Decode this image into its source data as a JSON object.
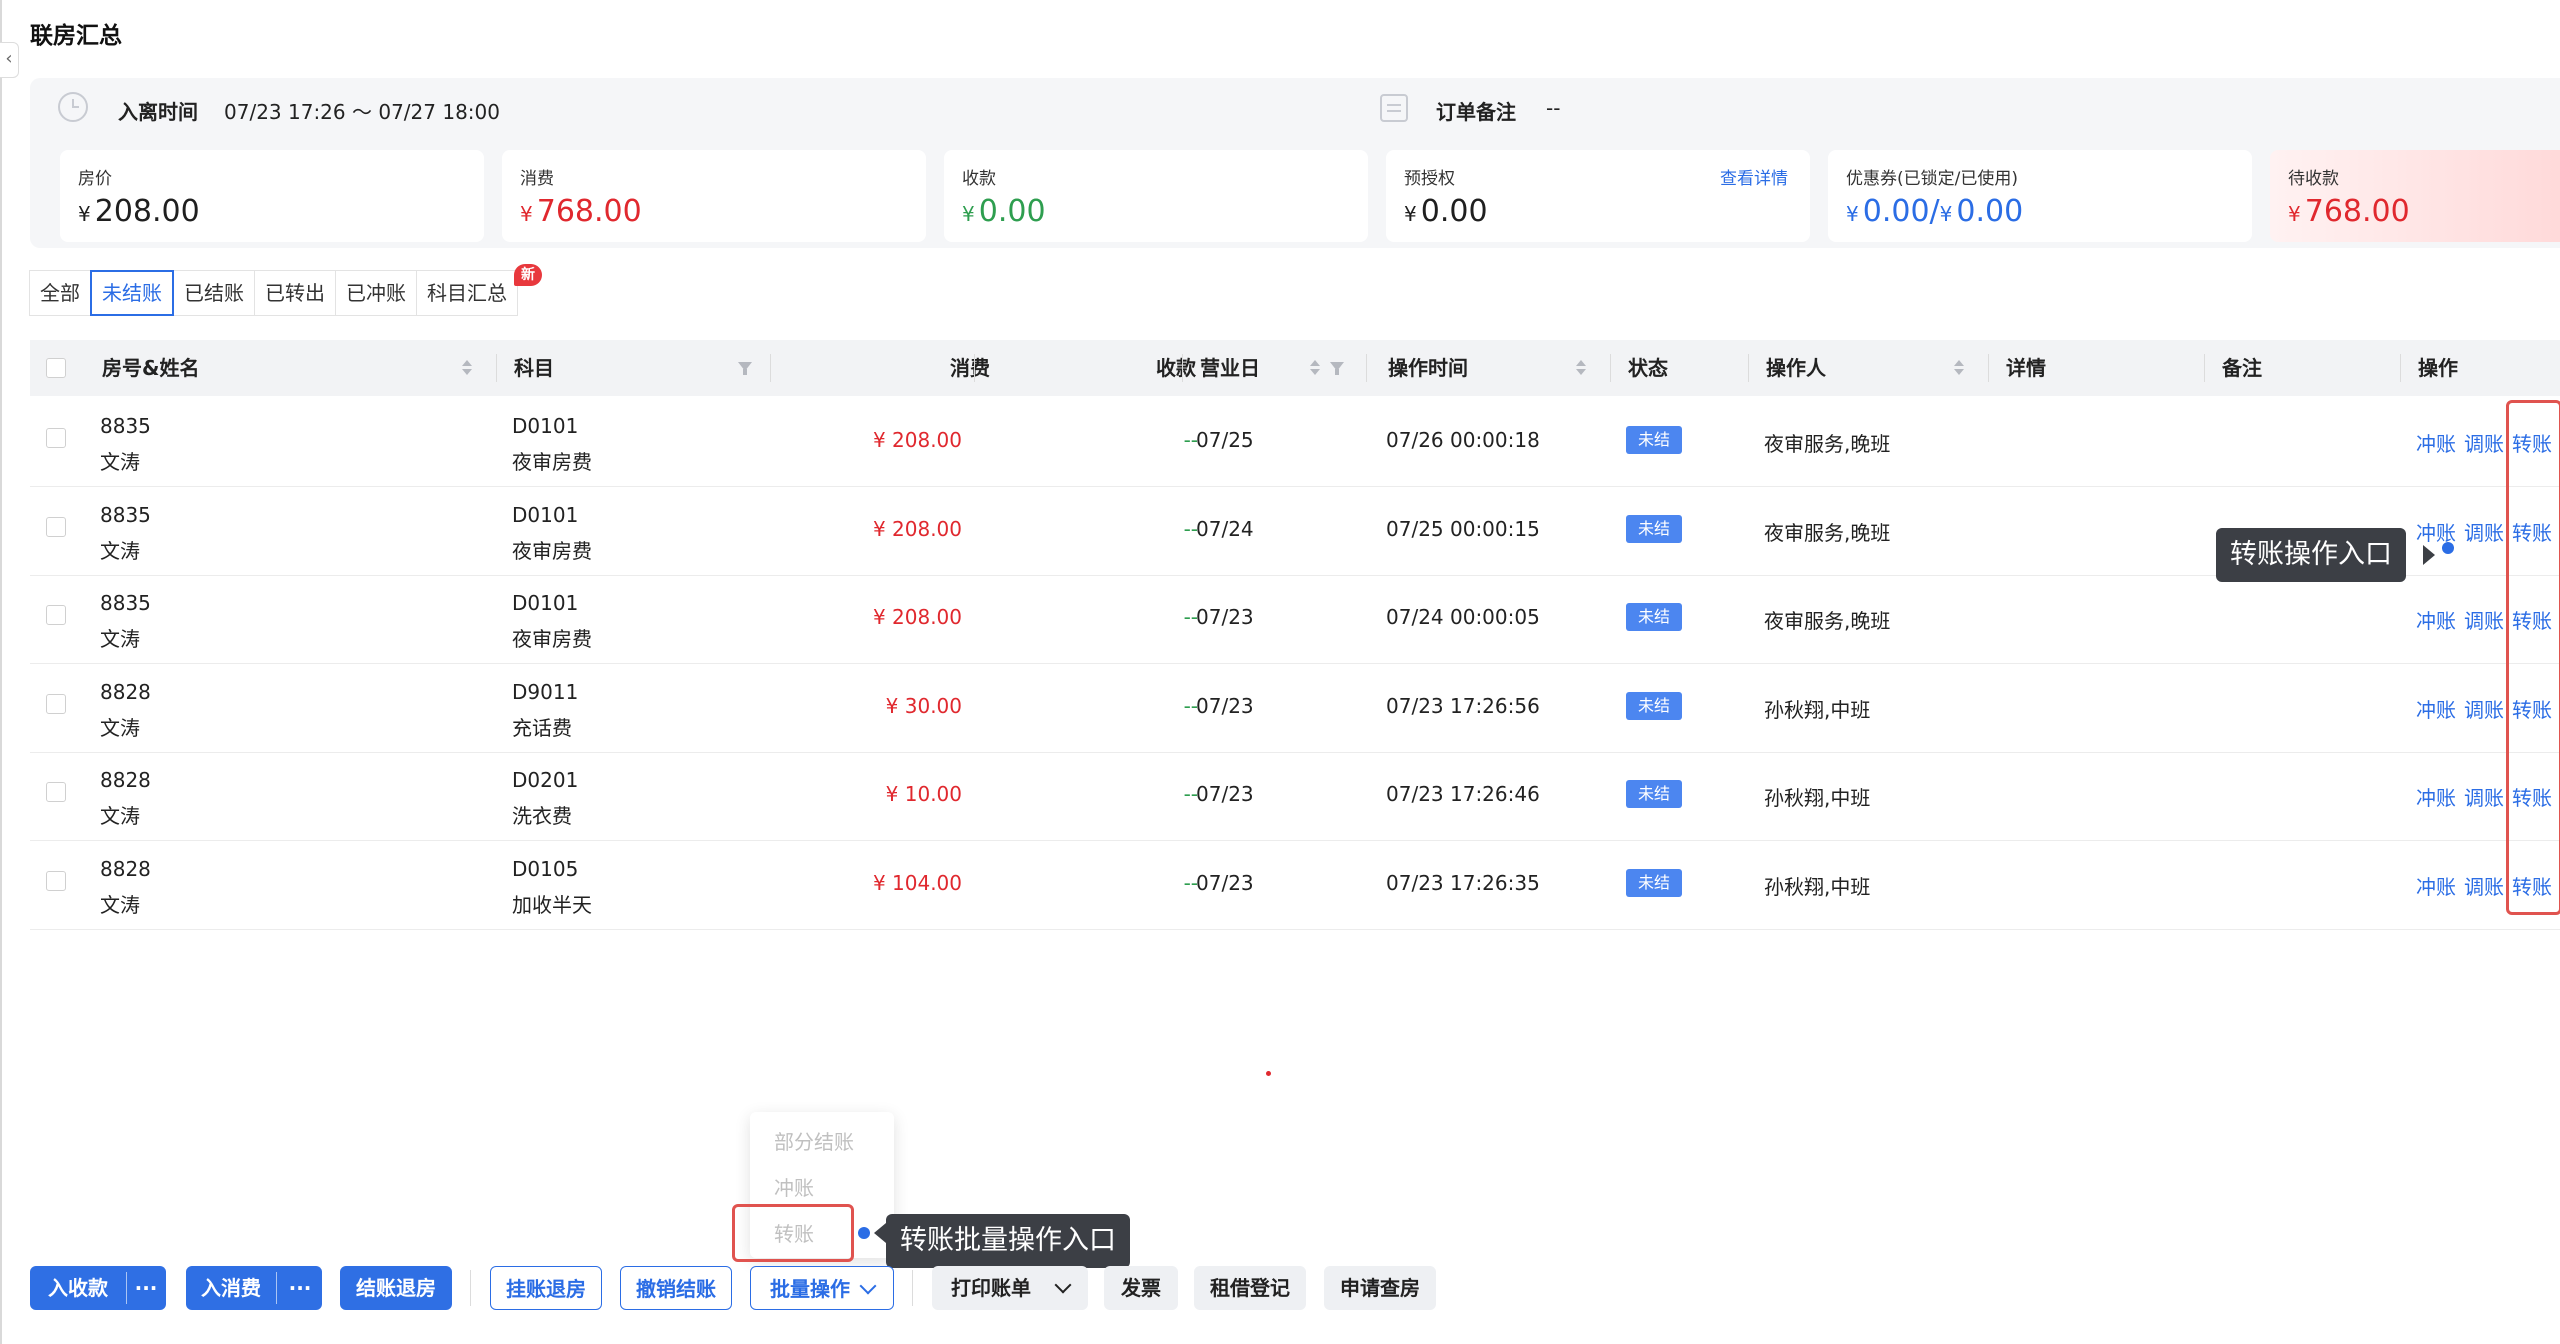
{
  "page_title": "联房汇总",
  "info": {
    "time_label": "入离时间",
    "time_value": "07/23 17:26 ～ 07/27 18:00",
    "remark_label": "订单备注",
    "remark_value": "--"
  },
  "cards": [
    {
      "label": "房价",
      "currency": "¥",
      "amount": "208.00",
      "color": "#1f1f1f"
    },
    {
      "label": "消费",
      "currency": "¥",
      "amount": "768.00",
      "color": "#e0282e"
    },
    {
      "label": "收款",
      "currency": "¥",
      "amount": "0.00",
      "color": "#2e9e4f"
    },
    {
      "label": "预授权",
      "currency": "¥",
      "amount": "0.00",
      "color": "#1f1f1f",
      "link": "查看详情"
    },
    {
      "label": "优惠券(已锁定/已使用)",
      "currency": "¥",
      "amount": "0.00/",
      "currency2": "¥",
      "amount2": "0.00",
      "color": "#2b6de5"
    },
    {
      "label": "待收款",
      "currency": "¥",
      "amount": "768.00",
      "color": "#e0282e"
    }
  ],
  "tabs": [
    "全部",
    "未结账",
    "已结账",
    "已转出",
    "已冲账",
    "科目汇总"
  ],
  "active_tab": "未结账",
  "new_badge": "新",
  "columns": [
    "房号&姓名",
    "科目",
    "消费",
    "收款",
    "营业日",
    "操作时间",
    "状态",
    "操作人",
    "详情",
    "备注",
    "操作"
  ],
  "rows": [
    {
      "room": "8835",
      "name": "文涛",
      "code": "D0101",
      "item": "夜审房费",
      "amount": "¥ 208.00",
      "receipt": "--",
      "bizday": "07/25",
      "optime": "07/26 00:00:18",
      "status": "未结",
      "operator": "夜审服务,晚班"
    },
    {
      "room": "8835",
      "name": "文涛",
      "code": "D0101",
      "item": "夜审房费",
      "amount": "¥ 208.00",
      "receipt": "--",
      "bizday": "07/24",
      "optime": "07/25 00:00:15",
      "status": "未结",
      "operator": "夜审服务,晚班"
    },
    {
      "room": "8835",
      "name": "文涛",
      "code": "D0101",
      "item": "夜审房费",
      "amount": "¥ 208.00",
      "receipt": "--",
      "bizday": "07/23",
      "optime": "07/24 00:00:05",
      "status": "未结",
      "operator": "夜审服务,晚班"
    },
    {
      "room": "8828",
      "name": "文涛",
      "code": "D9011",
      "item": "充话费",
      "amount": "¥ 30.00",
      "receipt": "--",
      "bizday": "07/23",
      "optime": "07/23 17:26:56",
      "status": "未结",
      "operator": "孙秋翔,中班"
    },
    {
      "room": "8828",
      "name": "文涛",
      "code": "D0201",
      "item": "洗衣费",
      "amount": "¥ 10.00",
      "receipt": "--",
      "bizday": "07/23",
      "optime": "07/23 17:26:46",
      "status": "未结",
      "operator": "孙秋翔,中班"
    },
    {
      "room": "8828",
      "name": "文涛",
      "code": "D0105",
      "item": "加收半天",
      "amount": "¥ 104.00",
      "receipt": "--",
      "bizday": "07/23",
      "optime": "07/23 17:26:35",
      "status": "未结",
      "operator": "孙秋翔,中班"
    }
  ],
  "row_actions": [
    "冲账",
    "调账",
    "转账"
  ],
  "tooltip_row": "转账操作入口",
  "tooltip_batch": "转账批量操作入口",
  "batch_menu": [
    "部分结账",
    "冲账",
    "转账"
  ],
  "buttons": {
    "receipt": "入收款",
    "consume": "入消费",
    "more": "···",
    "checkout": "结账退房",
    "hang": "挂账退房",
    "undo": "撤销结账",
    "batch": "批量操作",
    "print": "打印账单",
    "invoice": "发票",
    "rent": "租借登记",
    "inspect": "申请查房"
  }
}
